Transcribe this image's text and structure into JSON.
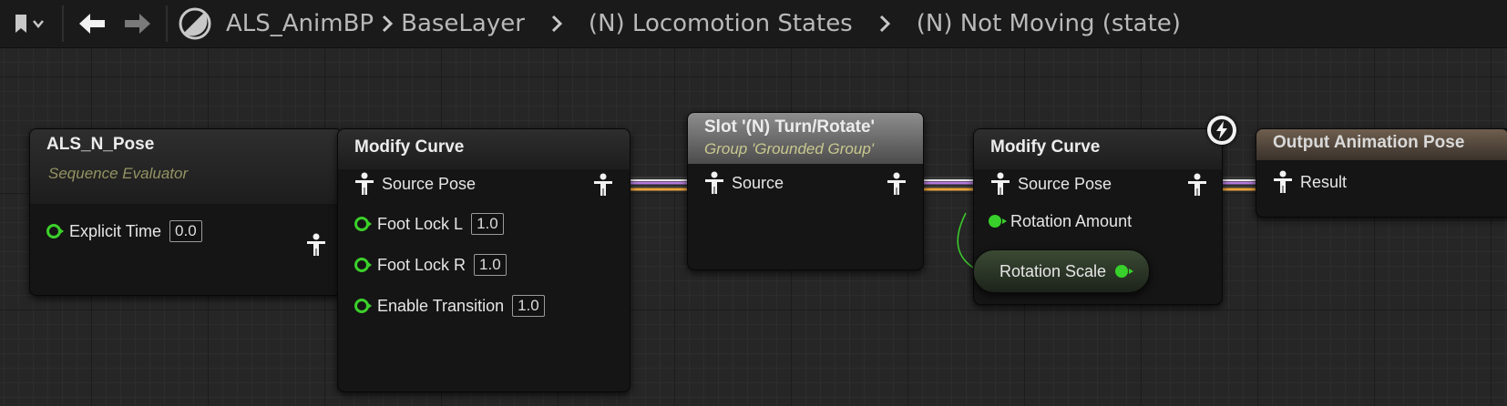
{
  "toolbar": {
    "bookmark_icon": "bookmark-icon",
    "back_icon": "arrow-left-icon",
    "forward_icon": "arrow-right-icon",
    "asset_icon": "anim-blueprint-icon"
  },
  "breadcrumb": {
    "items": [
      "ALS_AnimBP",
      "BaseLayer",
      "(N) Locomotion States",
      "(N) Not Moving (state)"
    ]
  },
  "nodes": {
    "pose": {
      "title": "ALS_N_Pose",
      "subtitle": "Sequence Evaluator",
      "explicit_time_label": "Explicit Time",
      "explicit_time_value": "0.0"
    },
    "modify1": {
      "title": "Modify Curve",
      "source_pose": "Source Pose",
      "pins": [
        {
          "label": "Foot Lock L",
          "value": "1.0"
        },
        {
          "label": "Foot Lock R",
          "value": "1.0"
        },
        {
          "label": "Enable Transition",
          "value": "1.0"
        }
      ]
    },
    "slot": {
      "title": "Slot '(N) Turn/Rotate'",
      "subtitle": "Group 'Grounded Group'",
      "source": "Source"
    },
    "modify2": {
      "title": "Modify Curve",
      "source_pose": "Source Pose",
      "rotation_amount": "Rotation Amount",
      "fast_path_icon": "lightning-icon"
    },
    "rotation_scale": {
      "label": "Rotation Scale"
    },
    "output": {
      "title": "Output Animation Pose",
      "result": "Result"
    }
  },
  "colors": {
    "float_pin": "#3bd02a",
    "pose_wire_white": "#e8e8e8",
    "pose_wire_purple": "#b47ad9",
    "pose_wire_orange": "#e9a33a",
    "exec_wire": "#3a3a3a"
  }
}
